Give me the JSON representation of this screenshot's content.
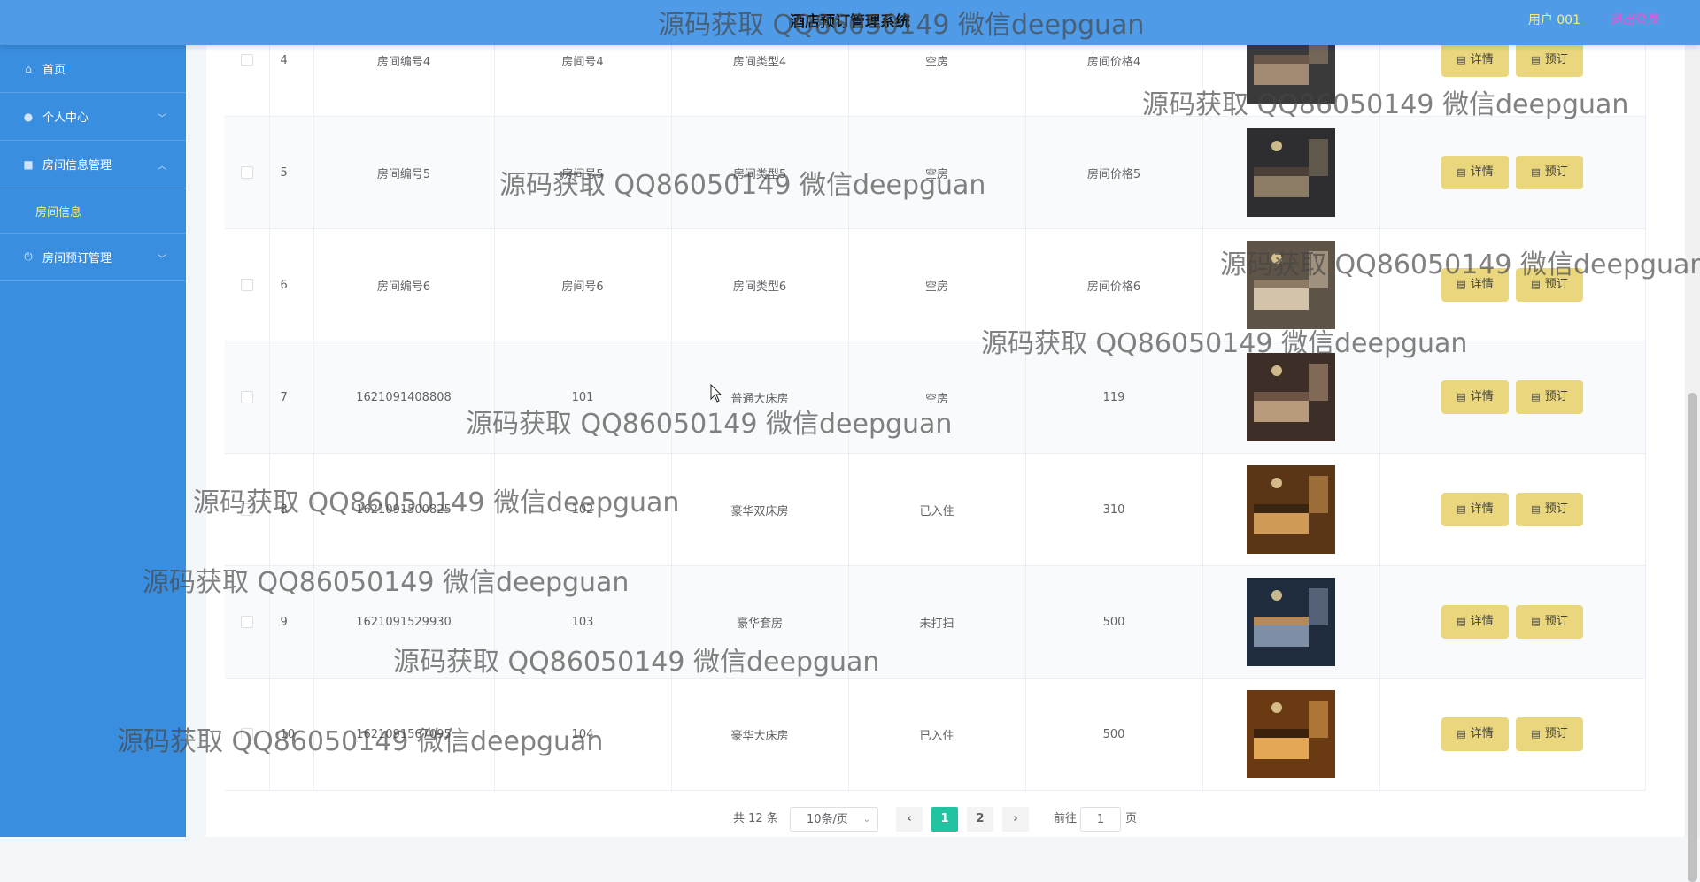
{
  "header": {
    "title": "酒店预订管理系统",
    "user": "用户 001",
    "logout": "退出登录"
  },
  "sidebar": {
    "items": [
      {
        "label": "首页",
        "icon": "home-icon"
      },
      {
        "label": "个人中心",
        "icon": "person-icon"
      },
      {
        "label": "房间信息管理",
        "icon": "briefcase-icon",
        "sub": "房间信息"
      },
      {
        "label": "房间预订管理",
        "icon": "power-icon"
      }
    ]
  },
  "table": {
    "detail_label": "详情",
    "book_label": "预订",
    "rows": [
      {
        "idx": "4",
        "room_no": "房间编号4",
        "room_num": "房间号4",
        "room_type": "房间类型4",
        "status": "空房",
        "price": "房间价格4",
        "image": "room-image"
      },
      {
        "idx": "5",
        "room_no": "房间编号5",
        "room_num": "房间号5",
        "room_type": "房间类型5",
        "status": "空房",
        "price": "房间价格5",
        "image": "room-image"
      },
      {
        "idx": "6",
        "room_no": "房间编号6",
        "room_num": "房间号6",
        "room_type": "房间类型6",
        "status": "空房",
        "price": "房间价格6",
        "image": "room-image"
      },
      {
        "idx": "7",
        "room_no": "1621091408808",
        "room_num": "101",
        "room_type": "普通大床房",
        "status": "空房",
        "price": "119",
        "image": "room-image"
      },
      {
        "idx": "8",
        "room_no": "1621091500825",
        "room_num": "102",
        "room_type": "豪华双床房",
        "status": "已入住",
        "price": "310",
        "image": "room-image"
      },
      {
        "idx": "9",
        "room_no": "1621091529930",
        "room_num": "103",
        "room_type": "豪华套房",
        "status": "未打扫",
        "price": "500",
        "image": "room-image"
      },
      {
        "idx": "10",
        "room_no": "1621091567095",
        "room_num": "104",
        "room_type": "豪华大床房",
        "status": "已入住",
        "price": "500",
        "image": "room-image"
      }
    ]
  },
  "pagination": {
    "total": "共 12 条",
    "page_size": "10条/页",
    "prev": "‹",
    "pages": [
      "1",
      "2"
    ],
    "current": "1",
    "next": "›",
    "goto_label": "前往",
    "goto_value": "1",
    "page_unit": "页"
  },
  "watermark": {
    "text": "源码获取 QQ86050149 微信deepguan"
  },
  "colors": {
    "topbar": "#4f9be8",
    "sidebar": "#3a8ee0",
    "button": "#ead77d",
    "active_page": "#21c3a0"
  }
}
